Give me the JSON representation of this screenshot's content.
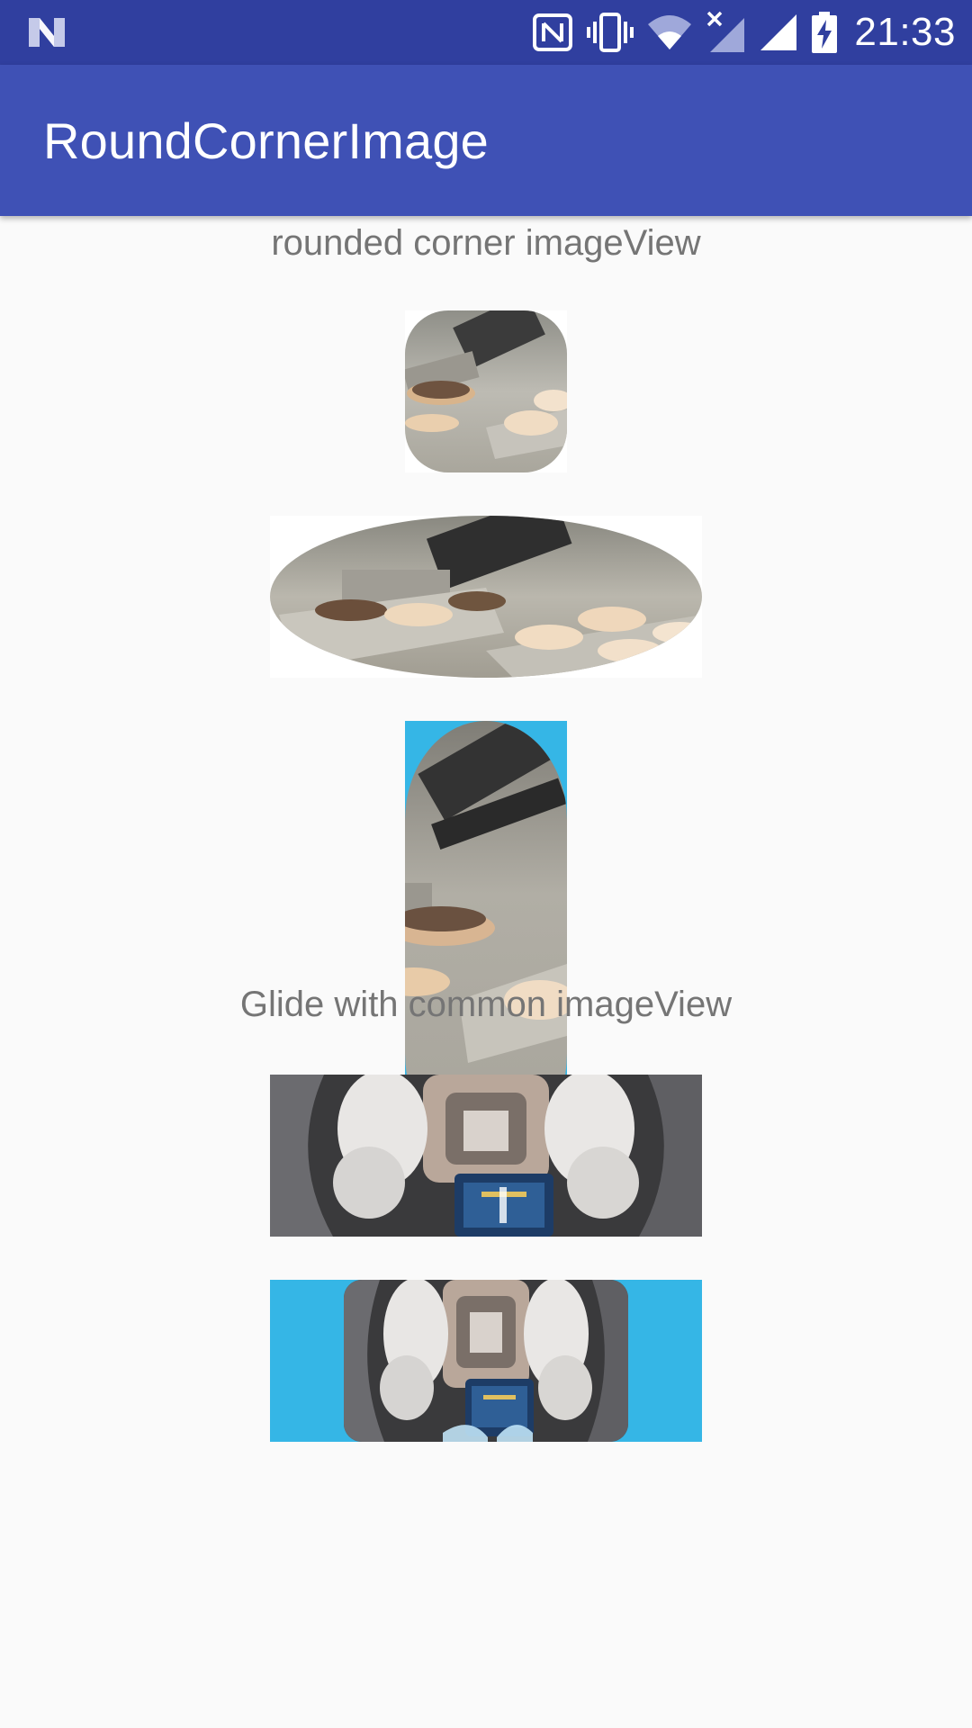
{
  "status_bar": {
    "time": "21:33",
    "icons": [
      "android-n-icon",
      "nfc-icon",
      "vibrate-icon",
      "wifi-icon",
      "mobile-signal-no-data-icon",
      "cell-signal-icon",
      "battery-charging-icon"
    ]
  },
  "app_bar": {
    "title": "RoundCornerImage"
  },
  "sections": {
    "rounded_label": "rounded corner imageView",
    "glide_label": "Glide with common imageView"
  },
  "colors": {
    "status_bar": "#303f9f",
    "app_bar": "#3f51b5",
    "accent_bg": "#35b6e6",
    "background": "#fafafa",
    "label_text": "#757575"
  },
  "images": [
    {
      "name": "burger-photo-rounded-square",
      "shape": "rounded-rect",
      "background": "#ffffff"
    },
    {
      "name": "burger-photo-rounded-wide",
      "shape": "pill-horizontal",
      "background": "#ffffff"
    },
    {
      "name": "burger-photo-rounded-tall",
      "shape": "pill-vertical",
      "background": "#35b6e6"
    },
    {
      "name": "astronauts-photo-glide",
      "shape": "rect"
    },
    {
      "name": "astronauts-photo-glide-rounded",
      "shape": "rounded-rect-centered",
      "background": "#35b6e6"
    }
  ]
}
